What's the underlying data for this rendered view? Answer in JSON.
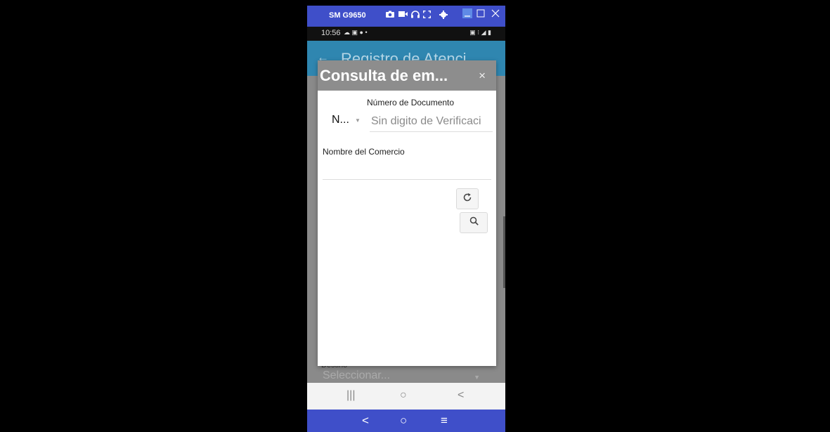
{
  "mirror_window": {
    "title": "SM G9650",
    "toolbar_icons": [
      "camera-icon",
      "video-icon",
      "headset-icon",
      "fullscreen-icon",
      "settings-icon"
    ],
    "controls": [
      "minimize-icon",
      "maximize-icon",
      "close-icon"
    ]
  },
  "status_bar": {
    "time": "10:56",
    "left_icons": "☁ ▣ ● •",
    "right_icons": "▣ ⁝ ◢ ▮"
  },
  "background_app": {
    "title": "Registro de Atenci",
    "destino_label": "Destino",
    "destino_value": "Seleccionar..."
  },
  "dialog": {
    "title": "Consulta de em...",
    "close_label": "×",
    "document_number_label": "Número de Documento",
    "document_type_value": "N...",
    "document_number_placeholder": "Sin digito de Verificaci",
    "business_name_label": "Nombre del Comercio",
    "business_name_value": ""
  },
  "buttons": {
    "refresh_icon": "refresh-icon",
    "search_icon": "search-icon"
  },
  "nav_light": {
    "recents": "|||",
    "home": "○",
    "back": "<"
  },
  "nav_dark": {
    "back": "<",
    "home": "○",
    "menu": "≡"
  },
  "colors": {
    "mirror_bar": "#3f4fc9",
    "app_header": "#2f86b0",
    "dialog_header": "#8d8d8d",
    "overlay": "#8a8a8a"
  }
}
